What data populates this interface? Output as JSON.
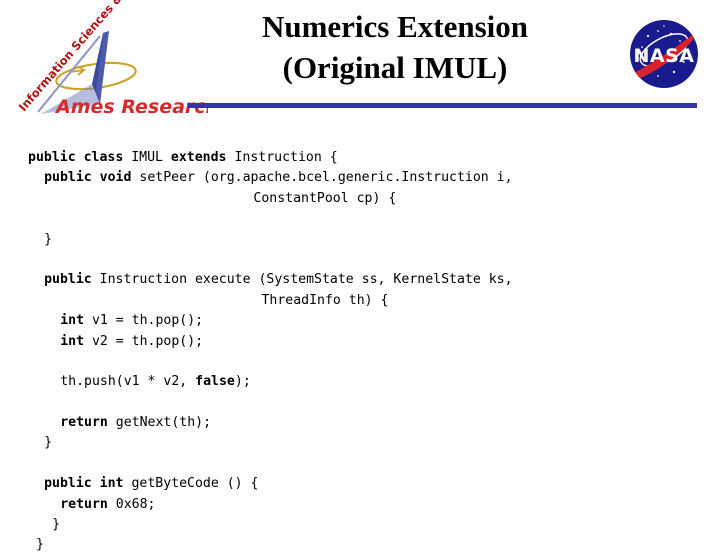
{
  "slide": {
    "title_lines": [
      "Numerics Extension",
      "(Original IMUL)"
    ],
    "accent_color": "#3333a8"
  },
  "ames_logo": {
    "diagonal_text": "Information Sciences & Technology",
    "name_text": "Ames Research Center",
    "text_color": "#d42b2b",
    "arrow_color": "#3b4a9e",
    "orbit_color": "#c9a227"
  },
  "nasa_logo": {
    "wordmark": "NASA",
    "circle_color": "#1a1a8f",
    "swoosh_color": "#d8232a",
    "text_color": "#ffffff"
  },
  "code": {
    "language": "java",
    "lines": [
      {
        "indent": 0,
        "segments": [
          {
            "t": "public class ",
            "b": true
          },
          {
            "t": "IMUL ",
            "b": false
          },
          {
            "t": "extends ",
            "b": true
          },
          {
            "t": "Instruction {",
            "b": false
          }
        ]
      },
      {
        "indent": 2,
        "segments": [
          {
            "t": "public void ",
            "b": true
          },
          {
            "t": "setPeer (org.apache.bcel.generic.Instruction i,",
            "b": false
          }
        ]
      },
      {
        "indent": 28,
        "segments": [
          {
            "t": "ConstantPool cp) {",
            "b": false
          }
        ]
      },
      {
        "indent": 0,
        "segments": []
      },
      {
        "indent": 2,
        "segments": [
          {
            "t": "}",
            "b": false
          }
        ]
      },
      {
        "indent": 0,
        "segments": []
      },
      {
        "indent": 2,
        "segments": [
          {
            "t": "public ",
            "b": true
          },
          {
            "t": "Instruction execute (SystemState ss, KernelState ks,",
            "b": false
          }
        ]
      },
      {
        "indent": 29,
        "segments": [
          {
            "t": "ThreadInfo th) {",
            "b": false
          }
        ]
      },
      {
        "indent": 4,
        "segments": [
          {
            "t": "int ",
            "b": true
          },
          {
            "t": "v1 = th.pop();",
            "b": false
          }
        ]
      },
      {
        "indent": 4,
        "segments": [
          {
            "t": "int ",
            "b": true
          },
          {
            "t": "v2 = th.pop();",
            "b": false
          }
        ]
      },
      {
        "indent": 0,
        "segments": []
      },
      {
        "indent": 4,
        "segments": [
          {
            "t": "th.push(v1 * v2, ",
            "b": false
          },
          {
            "t": "false",
            "b": true
          },
          {
            "t": ");",
            "b": false
          }
        ]
      },
      {
        "indent": 0,
        "segments": []
      },
      {
        "indent": 4,
        "segments": [
          {
            "t": "return ",
            "b": true
          },
          {
            "t": "getNext(th);",
            "b": false
          }
        ]
      },
      {
        "indent": 2,
        "segments": [
          {
            "t": "}",
            "b": false
          }
        ]
      },
      {
        "indent": 0,
        "segments": []
      },
      {
        "indent": 2,
        "segments": [
          {
            "t": "public int ",
            "b": true
          },
          {
            "t": "getByteCode () {",
            "b": false
          }
        ]
      },
      {
        "indent": 4,
        "segments": [
          {
            "t": "return ",
            "b": true
          },
          {
            "t": "0x68;",
            "b": false
          }
        ]
      },
      {
        "indent": 3,
        "segments": [
          {
            "t": "}",
            "b": false
          }
        ]
      },
      {
        "indent": 1,
        "segments": [
          {
            "t": "}",
            "b": false
          }
        ]
      }
    ]
  }
}
